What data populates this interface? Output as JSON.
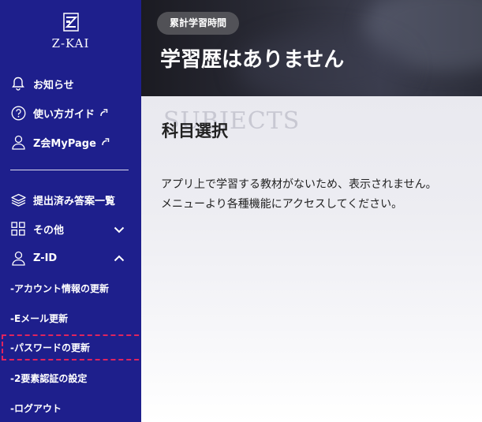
{
  "brand": {
    "logo_text": "Z-KAI"
  },
  "sidebar": {
    "items": [
      {
        "label": "お知らせ",
        "icon": "bell-icon"
      },
      {
        "label": "使い方ガイド",
        "icon": "help-circle-icon",
        "external": true
      },
      {
        "label": "Z会MyPage",
        "icon": "user-icon",
        "external": true
      },
      {
        "label": "提出済み答案一覧",
        "icon": "layers-icon"
      },
      {
        "label": "その他",
        "icon": "grid-icon",
        "expanded": false
      },
      {
        "label": "Z-ID",
        "icon": "user-icon",
        "expanded": true
      }
    ],
    "subitems": [
      {
        "label": "-アカウント情報の更新"
      },
      {
        "label": "-Eメール更新"
      },
      {
        "label": "-パスワードの更新",
        "highlighted": true
      },
      {
        "label": "-2要素認証の設定"
      },
      {
        "label": "-ログアウト"
      }
    ]
  },
  "header": {
    "badge": "累計学習時間",
    "title": "学習歴はありません"
  },
  "main": {
    "watermark": "SUBJECTS",
    "section_title": "科目選択",
    "message_line1": "アプリ上で学習する教材がないため、表示されません。",
    "message_line2": "メニューより各種機能にアクセスしてください。"
  },
  "colors": {
    "sidebar_bg": "#1e1f8c",
    "highlight_border": "#e0245e",
    "text_dark": "#222222"
  }
}
